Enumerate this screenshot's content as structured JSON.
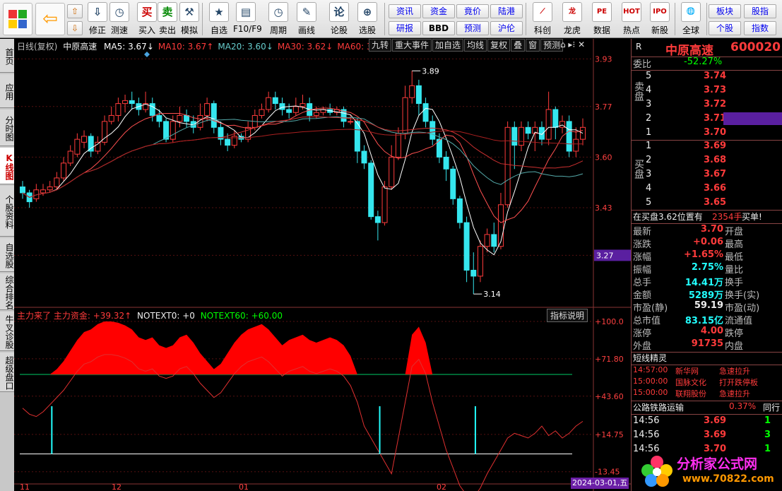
{
  "toolbar": {
    "buttons": [
      {
        "label": "修正",
        "icon": "⇩"
      },
      {
        "label": "测速",
        "icon": "◷"
      },
      {
        "label": "买入",
        "icon": "买"
      },
      {
        "label": "卖出",
        "icon": "卖"
      },
      {
        "label": "模拟",
        "icon": "⚒"
      },
      {
        "label": "自选",
        "icon": "★"
      },
      {
        "label": "F10/F9",
        "icon": "▤"
      },
      {
        "label": "周期",
        "icon": "◷"
      },
      {
        "label": "画线",
        "icon": "✎"
      },
      {
        "label": "论股",
        "icon": "论"
      },
      {
        "label": "选股",
        "icon": "⊕"
      }
    ],
    "small": [
      "资讯",
      "资金",
      "竟价",
      "陆港",
      "研报",
      "BBD",
      "预测",
      "沪伦"
    ],
    "right_buttons": [
      {
        "label": "科创",
        "icon": "⟋"
      },
      {
        "label": "龙虎",
        "icon": "龙"
      },
      {
        "label": "数据",
        "icon": "PE"
      },
      {
        "label": "热点",
        "icon": "HOT"
      },
      {
        "label": "新股",
        "icon": "IPO"
      },
      {
        "label": "全球",
        "icon": "🌐"
      }
    ],
    "far_small": [
      "板块",
      "股指",
      "个股",
      "指数"
    ]
  },
  "left_tabs": [
    "首页",
    "应用",
    "分时图",
    "K线图",
    "个股资料",
    "自选股",
    "综合排名",
    "牛叉诊股",
    "超级盘口"
  ],
  "chart": {
    "title": "日线(复权)",
    "stock": "中原高速",
    "ma": [
      {
        "label": "MA5: 3.67",
        "arrow": "↓",
        "color": "#ffffff"
      },
      {
        "label": "MA10: 3.67",
        "arrow": "↑",
        "color": "#ff3b3b"
      },
      {
        "label": "MA20: 3.60",
        "arrow": "↓",
        "color": "#66cccc"
      },
      {
        "label": "MA30: 3.62",
        "arrow": "↓",
        "color": "#ff3b3b"
      },
      {
        "label": "MA60: 3.66",
        "arrow": "↑",
        "color": "#ff3b3b"
      }
    ],
    "toolbar_btns": [
      "九转",
      "重大事件",
      "加自选",
      "均线",
      "复权",
      "叠",
      "窗",
      "预测"
    ],
    "y_labels": [
      "3.93",
      "3.77",
      "3.60",
      "3.43",
      "3.27"
    ],
    "current_price_tag": "3.27",
    "high_label": "3.89",
    "low_label": "3.14",
    "sub_legend": {
      "a": "主力来了",
      "b": "主力资金:",
      "b_val": "+39.32",
      "b_arrow": "↑",
      "c": "NOTEXT0:",
      "c_val": "+0",
      "d": "NOTEXT60:",
      "d_val": "+60.00"
    },
    "indicator_btn": "指标说明",
    "sub_y_labels": [
      "+100.0",
      "+71.80",
      "+43.60",
      "+14.75",
      "-13.45"
    ],
    "x_labels": [
      "11",
      "12",
      "01",
      "02"
    ],
    "date_tag": "2024-03-01,五"
  },
  "quote": {
    "name": "中原高速",
    "code": "600020",
    "r": "R",
    "weibi_label": "委比",
    "weibi": "-52.27%",
    "sell_label": "卖盘",
    "buy_label": "买盘",
    "asks": [
      {
        "n": "5",
        "p": "3.74",
        "v": ""
      },
      {
        "n": "4",
        "p": "3.73",
        "v": ""
      },
      {
        "n": "3",
        "p": "3.72",
        "v": ""
      },
      {
        "n": "2",
        "p": "3.71",
        "v": ""
      },
      {
        "n": "1",
        "p": "3.70",
        "v": ""
      }
    ],
    "bids": [
      {
        "n": "1",
        "p": "3.69",
        "v": ""
      },
      {
        "n": "2",
        "p": "3.68",
        "v": ""
      },
      {
        "n": "3",
        "p": "3.67",
        "v": ""
      },
      {
        "n": "4",
        "p": "3.66",
        "v": ""
      },
      {
        "n": "5",
        "p": "3.65",
        "v": ""
      }
    ],
    "info": "在买盘3.62位置有",
    "info_vol": "2354手",
    "info_tag": "买单!",
    "stats": [
      {
        "l": "最新",
        "v": "3.70",
        "c": "red",
        "l2": "开盘"
      },
      {
        "l": "涨跌",
        "v": "+0.06",
        "c": "red",
        "l2": "最高"
      },
      {
        "l": "涨幅",
        "v": "+1.65%",
        "c": "red",
        "l2": "最低"
      },
      {
        "l": "振幅",
        "v": "2.75%",
        "c": "cy",
        "l2": "量比"
      },
      {
        "l": "总手",
        "v": "14.41万",
        "c": "cy",
        "l2": "换手"
      },
      {
        "l": "金额",
        "v": "5289万",
        "c": "cy",
        "l2": "换手(实)"
      },
      {
        "l": "市盈(静)",
        "v": "59.19",
        "c": "wht",
        "l2": "市盈(动)"
      },
      {
        "l": "总市值",
        "v": "83.15亿",
        "c": "cy",
        "l2": "流通值"
      },
      {
        "l": "涨停",
        "v": "4.00",
        "c": "red",
        "l2": "跌停"
      },
      {
        "l": "外盘",
        "v": "91735",
        "c": "red",
        "l2": "内盘"
      }
    ],
    "flow_title": "短线精灵",
    "flow": [
      {
        "t": "14:57:00",
        "s": "新华网",
        "e": "急速拉升"
      },
      {
        "t": "15:00:00",
        "s": "国脉文化",
        "e": "打开跌停板"
      },
      {
        "t": "15:00:00",
        "s": "联翔股份",
        "e": "急速拉升"
      }
    ],
    "sector": "公路铁路运输",
    "sector_pct": "0.37%",
    "sector_tab": "同行",
    "ticks": [
      {
        "t": "14:56",
        "p": "3.69",
        "v": "1"
      },
      {
        "t": "14:56",
        "p": "3.69",
        "v": "3"
      },
      {
        "t": "14:56",
        "p": "3.70",
        "v": "1"
      }
    ]
  },
  "watermark": {
    "text": "分析家公式网",
    "url": "www.70822.com"
  }
}
